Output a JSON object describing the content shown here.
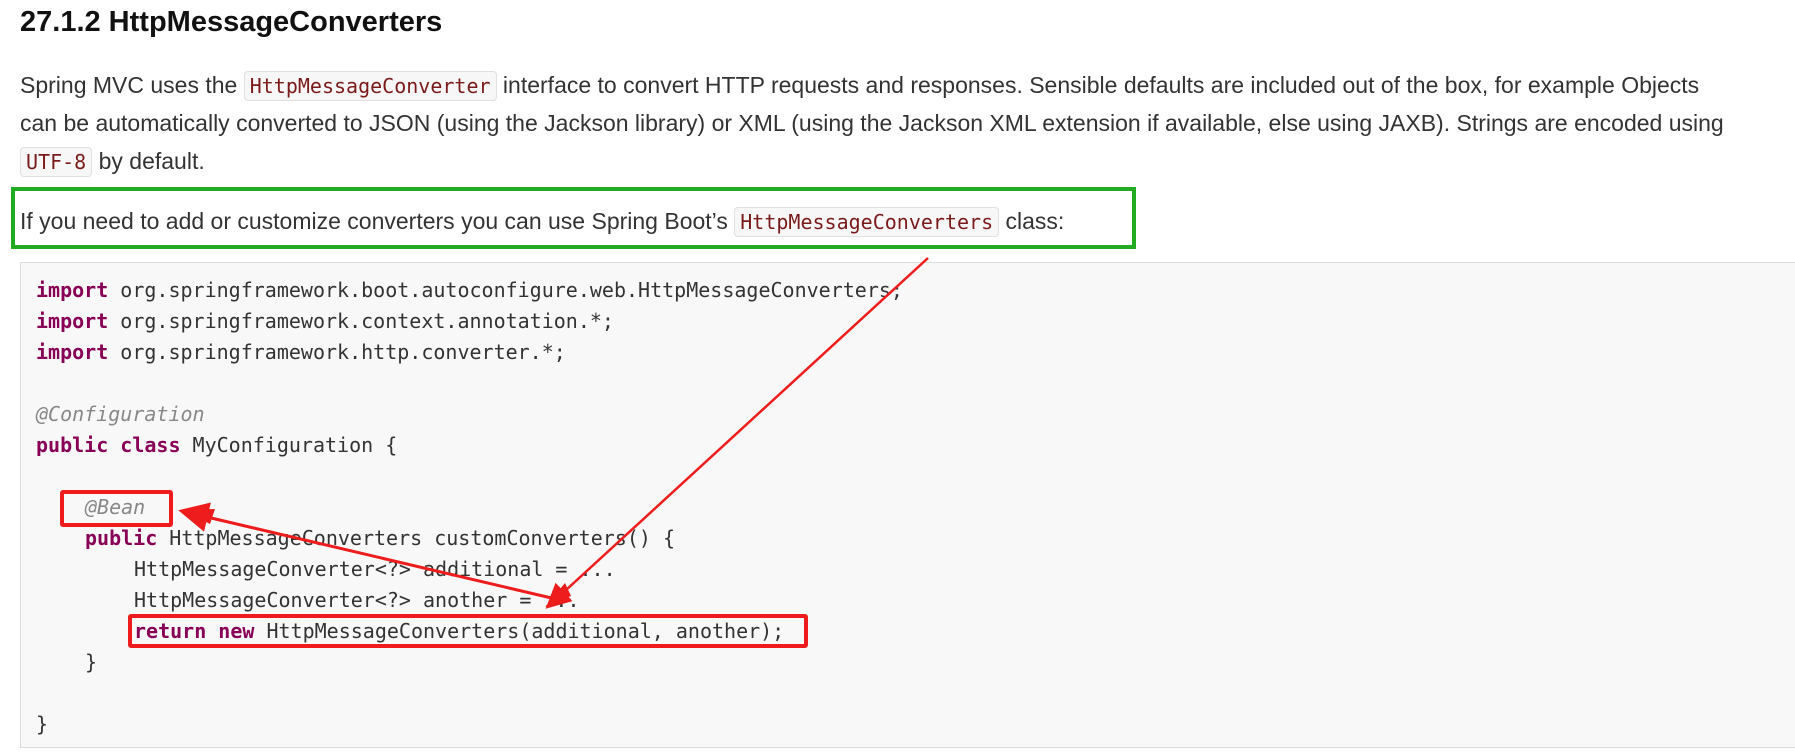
{
  "heading": "27.1.2 HttpMessageConverters",
  "intro": {
    "line1_a": "Spring MVC uses the ",
    "line1_code": "HttpMessageConverter",
    "line1_b": " interface to convert HTTP requests and responses. Sensible defaults are included out of the box, for example Objects",
    "line2": "can be automatically converted to JSON (using the Jackson library) or XML (using the Jackson XML extension if available, else using JAXB). Strings are encoded using",
    "line3_code": "UTF-8",
    "line3_b": " by default."
  },
  "note": {
    "a": "If you need to add or customize converters you can use Spring Boot’s ",
    "code": "HttpMessageConverters",
    "b": " class:"
  },
  "code": {
    "l1_kw": "import",
    "l1": " org.springframework.boot.autoconfigure.web.HttpMessageConverters;",
    "l2_kw": "import",
    "l2": " org.springframework.context.annotation.*;",
    "l3_kw": "import",
    "l3": " org.springframework.http.converter.*;",
    "l5_ann": "@Configuration",
    "l6_kw": "public class",
    "l6": " MyConfiguration {",
    "l8_ann": "@Bean",
    "l9_kw": "public",
    "l9": " HttpMessageConverters customConverters() {",
    "l10": "HttpMessageConverter<?> additional = ...",
    "l11": "HttpMessageConverter<?> another = ...",
    "l12_kw": "return new",
    "l12": " HttpMessageConverters(additional, another);",
    "l13": "}",
    "l15": "}"
  },
  "colors": {
    "highlight_green": "#22aa22",
    "annotation_red": "#ee1c1c",
    "keyword": "#880055",
    "inline_code": "#7b1a1a"
  }
}
